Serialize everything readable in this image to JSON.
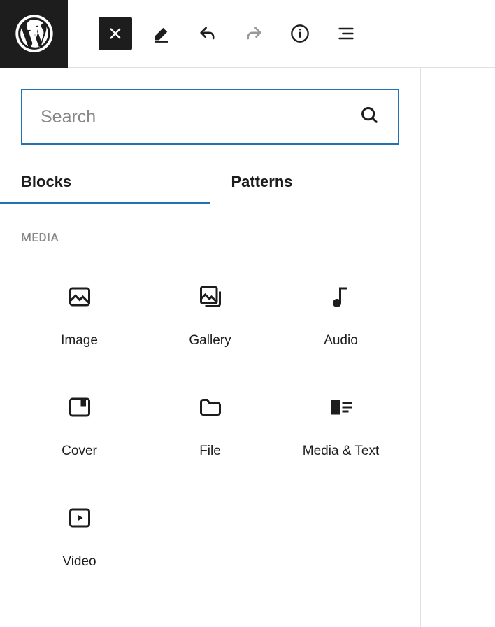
{
  "search": {
    "placeholder": "Search"
  },
  "tabs": {
    "blocks": "Blocks",
    "patterns": "Patterns",
    "active": "blocks"
  },
  "category": {
    "label": "MEDIA"
  },
  "blocks": {
    "image": "Image",
    "gallery": "Gallery",
    "audio": "Audio",
    "cover": "Cover",
    "file": "File",
    "media_text": "Media & Text",
    "video": "Video"
  }
}
